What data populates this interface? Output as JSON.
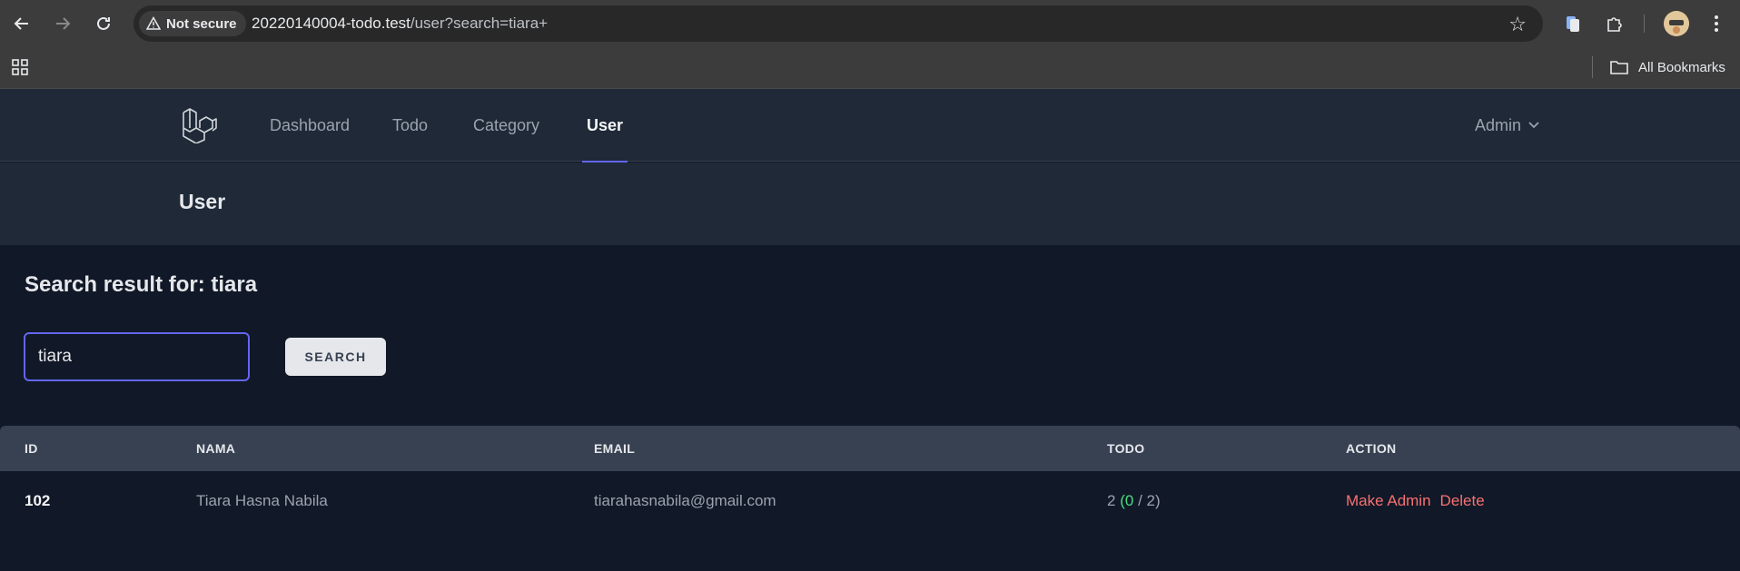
{
  "browser": {
    "security_label": "Not secure",
    "url_host": "20220140004-todo.test",
    "url_path": "/user?search=tiara+",
    "all_bookmarks": "All Bookmarks"
  },
  "nav": {
    "items": [
      {
        "label": "Dashboard"
      },
      {
        "label": "Todo"
      },
      {
        "label": "Category"
      },
      {
        "label": "User"
      }
    ],
    "active": "User",
    "user_menu": "Admin"
  },
  "header": {
    "title": "User"
  },
  "search": {
    "result_title": "Search result for: tiara",
    "value": "tiara",
    "button_label": "SEARCH"
  },
  "table": {
    "columns": [
      "ID",
      "NAMA",
      "EMAIL",
      "TODO",
      "ACTION"
    ],
    "rows": [
      {
        "id": "102",
        "nama": "Tiara Hasna Nabila",
        "email": "tiarahasnabila@gmail.com",
        "todo_total": "2",
        "todo_done": "0",
        "todo_open": "/ 2)",
        "actions": [
          "Make Admin",
          "Delete"
        ]
      }
    ]
  },
  "colors": {
    "accent": "#6366f1",
    "danger": "#f87171",
    "success": "#4ade80"
  }
}
